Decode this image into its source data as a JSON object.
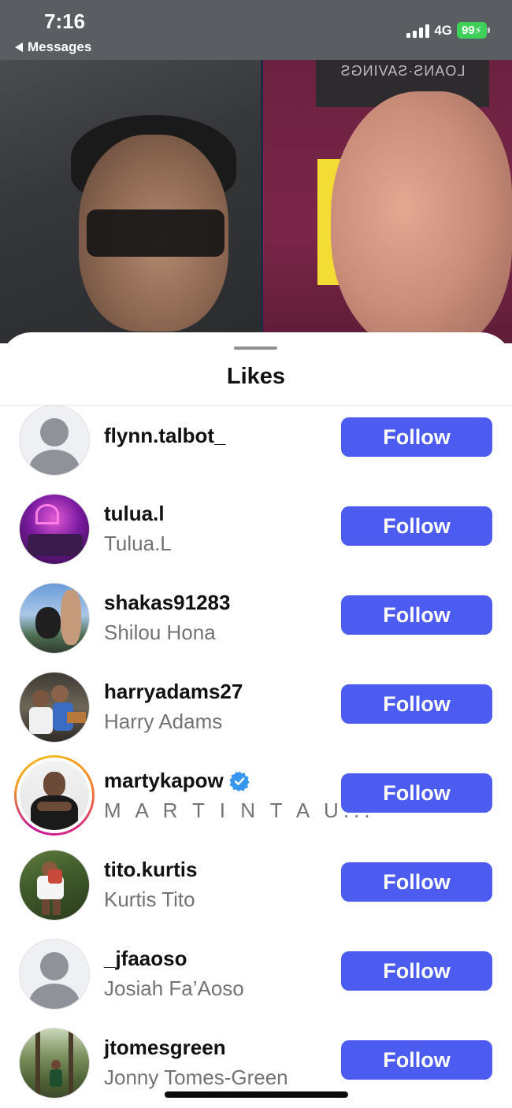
{
  "status_bar": {
    "time": "7:16",
    "back_label": "Messages",
    "network": "4G",
    "battery": "99"
  },
  "video": {
    "sign_text": "LOANS·SAVINGS"
  },
  "sheet": {
    "title": "Likes",
    "follow_label": "Follow",
    "users": [
      {
        "username": "flynn.talbot_",
        "full_name": ""
      },
      {
        "username": "tulua.l",
        "full_name": "Tulua.L"
      },
      {
        "username": "shakas91283",
        "full_name": "Shilou Hona"
      },
      {
        "username": "harryadams27",
        "full_name": "Harry Adams"
      },
      {
        "username": "martykapow",
        "full_name": "M A R T I N  T A U...",
        "verified": true,
        "has_story": true
      },
      {
        "username": "tito.kurtis",
        "full_name": "Kurtis Tito"
      },
      {
        "username": "_jfaaoso",
        "full_name": "Josiah Fa’Aoso"
      },
      {
        "username": "jtomesgreen",
        "full_name": "Jonny Tomes-Green"
      }
    ]
  },
  "colors": {
    "follow_button": "#4c5cf1",
    "verified_badge": "#3797f0",
    "battery": "#3fd05a"
  }
}
